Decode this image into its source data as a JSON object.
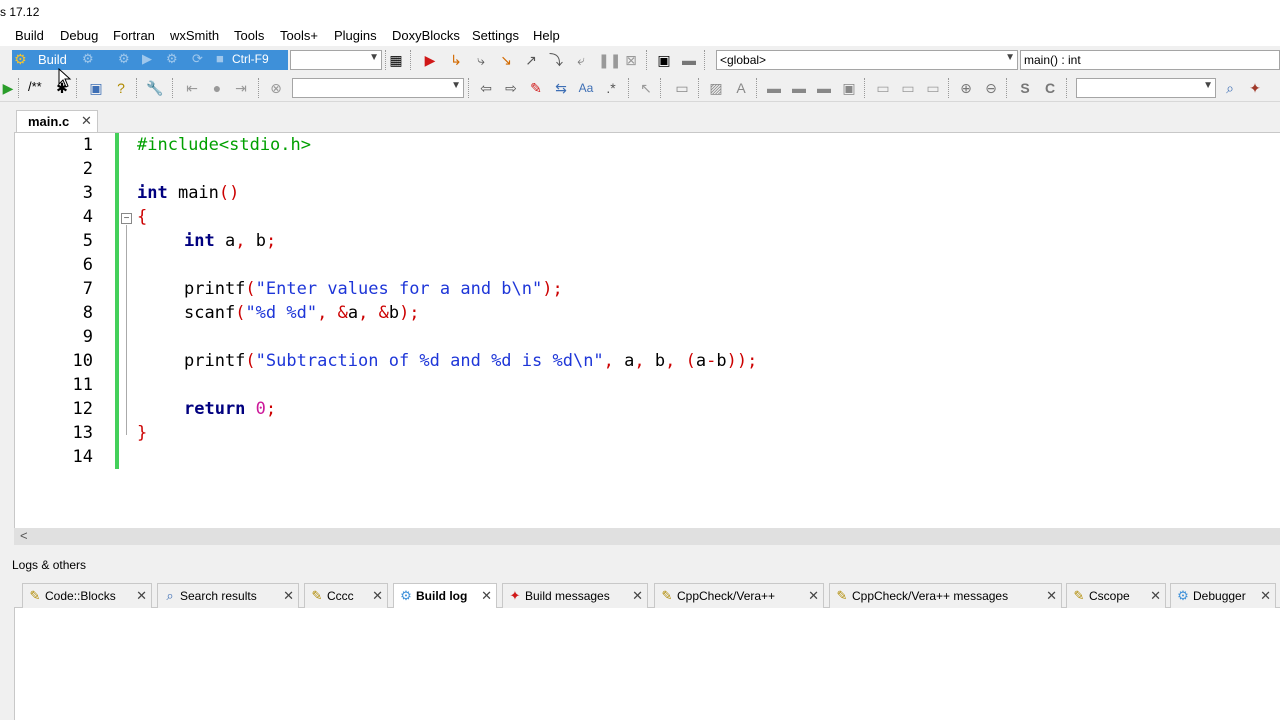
{
  "window": {
    "title": "s 17.12"
  },
  "menu": [
    "Build",
    "Debug",
    "Fortran",
    "wxSmith",
    "Tools",
    "Tools+",
    "Plugins",
    "DoxyBlocks",
    "Settings",
    "Help"
  ],
  "toolbar": {
    "build_label": "Build",
    "build_shortcut": "Ctrl-F9",
    "scope_combo": "<global>",
    "function_combo": "main() : int",
    "comment_label": "/**"
  },
  "editor": {
    "tab_label": "main.c",
    "lines": [
      "1",
      "2",
      "3",
      "4",
      "5",
      "6",
      "7",
      "8",
      "9",
      "10",
      "11",
      "12",
      "13",
      "14"
    ],
    "code": {
      "l1": "#include<stdio.h>",
      "l3_kw": "int",
      "l3_rest": " main",
      "l3_paren": "()",
      "l4": "{",
      "l5_kw": "int",
      "l5_rest": " a",
      "l5_comma": ",",
      "l5_b": " b",
      "l5_semi": ";",
      "l7_fn": "printf",
      "l7_open": "(",
      "l7_str": "\"Enter values for a and b\\n\"",
      "l7_close": ");",
      "l8_fn": "scanf",
      "l8_open": "(",
      "l8_str": "\"%d %d\"",
      "l8_rest1": ", ",
      "l8_amp1": "&",
      "l8_a": "a",
      "l8_rest2": ", ",
      "l8_amp2": "&",
      "l8_b": "b",
      "l8_close": ");",
      "l10_fn": "printf",
      "l10_open": "(",
      "l10_str": "\"Subtraction of %d and %d is %d\\n\"",
      "l10_c1": ",",
      "l10_a": " a",
      "l10_c2": ",",
      "l10_b": " b",
      "l10_c3": ",",
      "l10_p1": " (",
      "l10_ab": "a",
      "l10_minus": "-",
      "l10_bb": "b",
      "l10_close": "));",
      "l12_kw": "return",
      "l12_num": "0",
      "l12_semi": ";",
      "l13": "}"
    }
  },
  "logs": {
    "title": "Logs & others",
    "tabs": [
      {
        "label": "Code::Blocks",
        "icon": "pencil-icon"
      },
      {
        "label": "Search results",
        "icon": "magnifier-icon"
      },
      {
        "label": "Cccc",
        "icon": "pencil-icon"
      },
      {
        "label": "Build log",
        "icon": "gear-icon"
      },
      {
        "label": "Build messages",
        "icon": "pin-icon"
      },
      {
        "label": "CppCheck/Vera++",
        "icon": "pencil-icon"
      },
      {
        "label": "CppCheck/Vera++ messages",
        "icon": "pencil-icon"
      },
      {
        "label": "Cscope",
        "icon": "pencil-icon"
      },
      {
        "label": "Debugger",
        "icon": "gear-icon"
      }
    ]
  },
  "colors": {
    "accent": "#3e90d9",
    "change_bar": "#44d05a",
    "keyword": "#00007f",
    "string": "#1e36d8",
    "operator": "#cc0000",
    "preprocessor": "#00a000"
  }
}
